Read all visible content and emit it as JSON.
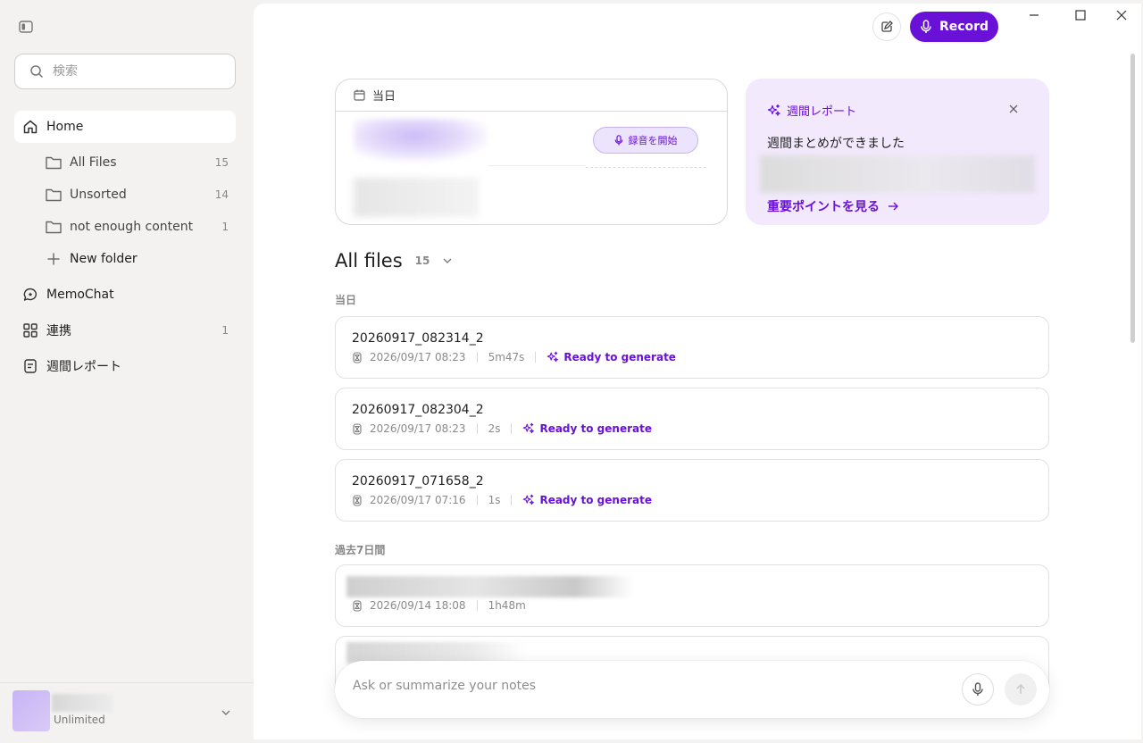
{
  "sidebar": {
    "search_placeholder": "検索",
    "home_label": "Home",
    "folders": [
      {
        "label": "All Files",
        "count": "15"
      },
      {
        "label": "Unsorted",
        "count": "14"
      },
      {
        "label": "not enough content",
        "count": "1"
      }
    ],
    "new_folder_label": "New folder",
    "memochat_label": "MemoChat",
    "integrations_label": "連携",
    "integrations_count": "1",
    "weekly_label": "週間レポート",
    "plan_label": "Unlimited"
  },
  "header": {
    "record_label": "Record"
  },
  "today_card": {
    "title": "当日",
    "start_label": "録音を開始"
  },
  "weekly_card": {
    "title": "週間レポート",
    "message": "週間まとめができました",
    "link_label": "重要ポイントを見る"
  },
  "files": {
    "title": "All files",
    "count": "15",
    "section_today": "当日",
    "section_week": "過去7日間",
    "today_items": [
      {
        "name": "20260917_082314_2",
        "datetime": "2026/09/17 08:23",
        "duration": "5m47s",
        "status": "Ready to generate"
      },
      {
        "name": "20260917_082304_2",
        "datetime": "2026/09/17 08:23",
        "duration": "2s",
        "status": "Ready to generate"
      },
      {
        "name": "20260917_071658_2",
        "datetime": "2026/09/17 07:16",
        "duration": "1s",
        "status": "Ready to generate"
      }
    ],
    "week_items": [
      {
        "datetime": "2026/09/14 18:08",
        "duration": "1h48m"
      }
    ]
  },
  "ask": {
    "placeholder": "Ask or summarize your notes"
  },
  "colors": {
    "accent": "#6a11d8",
    "accent_soft": "#f2e9fd",
    "sidebar_bg": "#f3f2f1"
  },
  "icons": {
    "sidebar_toggle": "sidebar-toggle-icon",
    "search": "search-icon",
    "home": "home-icon",
    "folder": "folder-icon",
    "plus": "plus-icon",
    "chat": "chat-bubble-icon",
    "integrations": "grid-icon",
    "report": "document-icon",
    "mic": "microphone-icon",
    "sparkle": "sparkle-icon",
    "calendar": "calendar-icon",
    "clock": "hourglass-icon",
    "send": "arrow-up-icon"
  }
}
